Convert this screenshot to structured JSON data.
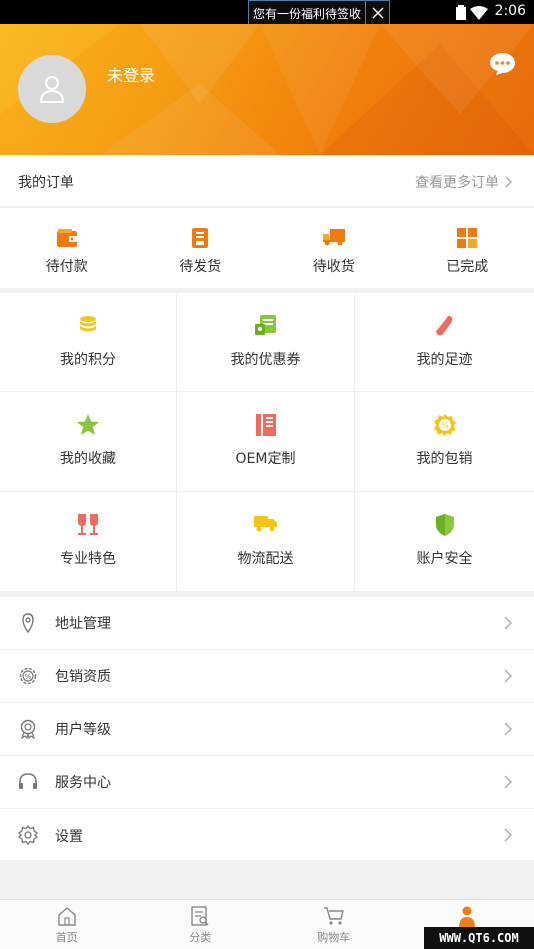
{
  "status_bar": {
    "time": "2:06",
    "notification": "您有一份福利待签收"
  },
  "profile": {
    "login_text": "未登录"
  },
  "orders": {
    "title": "我的订单",
    "more": "查看更多订单",
    "items": [
      {
        "label": "待付款",
        "icon": "wallet-icon"
      },
      {
        "label": "待发货",
        "icon": "package-icon"
      },
      {
        "label": "待收货",
        "icon": "truck-icon"
      },
      {
        "label": "已完成",
        "icon": "grid-icon"
      }
    ]
  },
  "grid": [
    {
      "label": "我的积分",
      "icon": "coins-icon",
      "color": "#f5c518"
    },
    {
      "label": "我的优惠券",
      "icon": "coupon-icon",
      "color": "#8cc63f"
    },
    {
      "label": "我的足迹",
      "icon": "footprint-icon",
      "color": "#f26a5b"
    },
    {
      "label": "我的收藏",
      "icon": "star-icon",
      "color": "#8cc63f"
    },
    {
      "label": "OEM定制",
      "icon": "book-icon",
      "color": "#f26a5b"
    },
    {
      "label": "我的包销",
      "icon": "percent-badge-icon",
      "color": "#f5c518"
    },
    {
      "label": "专业特色",
      "icon": "wine-glasses-icon",
      "color": "#f26a5b"
    },
    {
      "label": "物流配送",
      "icon": "delivery-truck-icon",
      "color": "#f5c518"
    },
    {
      "label": "账户安全",
      "icon": "shield-icon",
      "color": "#8cc63f"
    }
  ],
  "menu": [
    {
      "label": "地址管理",
      "icon": "location-pin-icon"
    },
    {
      "label": "包销资质",
      "icon": "percent-gear-icon"
    },
    {
      "label": "用户等级",
      "icon": "medal-icon"
    },
    {
      "label": "服务中心",
      "icon": "headphones-icon"
    },
    {
      "label": "设置",
      "icon": "settings-gear-icon"
    }
  ],
  "tabs": [
    {
      "label": "首页",
      "icon": "home-icon"
    },
    {
      "label": "分类",
      "icon": "category-icon"
    },
    {
      "label": "购物车",
      "icon": "cart-icon"
    },
    {
      "label": "",
      "icon": "person-icon",
      "active": true
    }
  ],
  "watermark": "WWW.QT6.COM",
  "colors": {
    "accent": "#ef7d10",
    "header_start": "#f9b31d",
    "header_end": "#e86a0a"
  }
}
